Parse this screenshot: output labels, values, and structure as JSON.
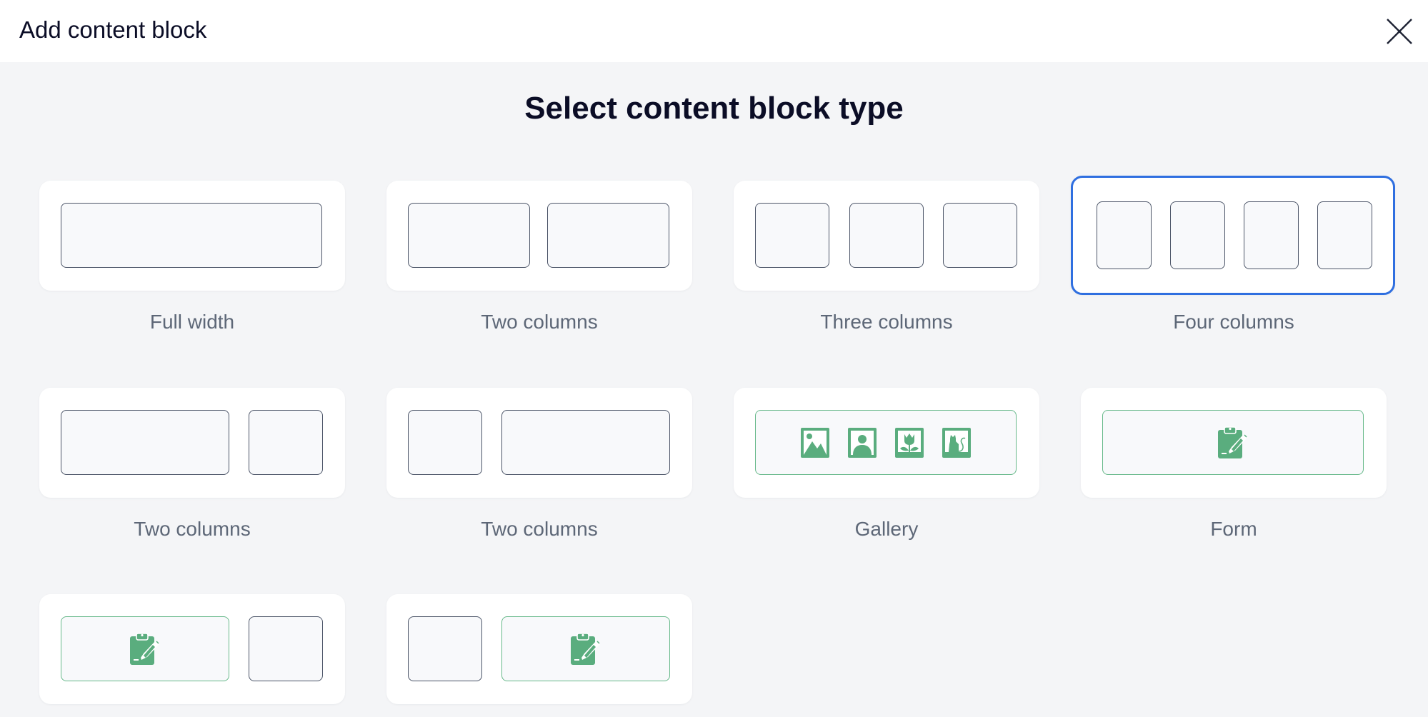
{
  "header": {
    "title": "Add content block"
  },
  "main": {
    "title": "Select content block type"
  },
  "blocks": [
    {
      "label": "Full width",
      "selected": false
    },
    {
      "label": "Two columns",
      "selected": false
    },
    {
      "label": "Three columns",
      "selected": false
    },
    {
      "label": "Four columns",
      "selected": true
    },
    {
      "label": "Two columns",
      "selected": false
    },
    {
      "label": "Two columns",
      "selected": false
    },
    {
      "label": "Gallery",
      "selected": false
    },
    {
      "label": "Form",
      "selected": false
    },
    {
      "label": "",
      "selected": false
    },
    {
      "label": "",
      "selected": false
    }
  ],
  "colors": {
    "accent": "#2f6fe0",
    "green": "#5aad7e",
    "box_border": "#4c5568",
    "background": "#f4f5f7"
  },
  "icons": {
    "close": "close-icon",
    "gallery": [
      "landscape-image-icon",
      "portrait-image-icon",
      "flower-image-icon",
      "cat-image-icon"
    ],
    "form": "clipboard-edit-icon"
  }
}
